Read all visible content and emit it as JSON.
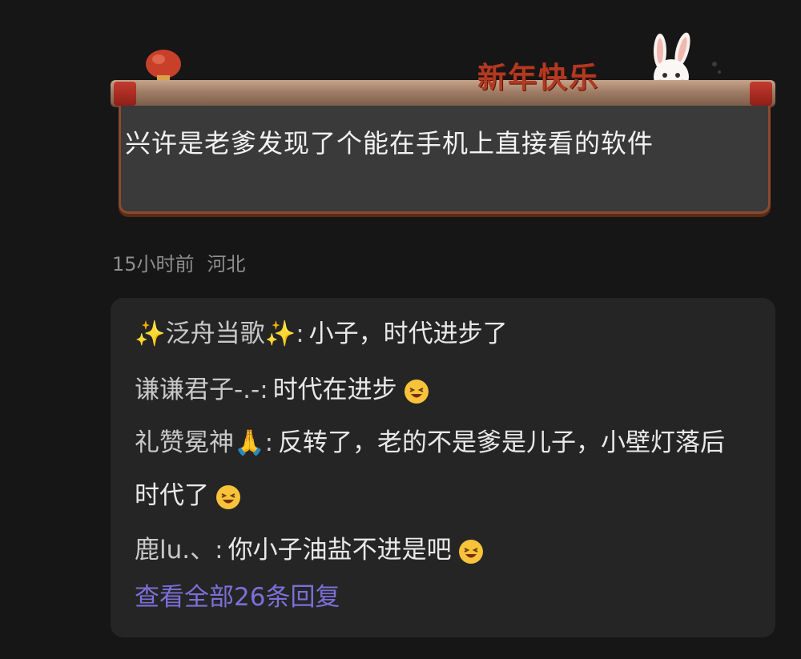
{
  "banner": {
    "title": "新年快乐",
    "comment_text": "兴许是老爹发现了个能在手机上直接看的软件"
  },
  "meta": {
    "time": "15小时前",
    "location": "河北"
  },
  "replies": [
    {
      "name": "✨泛舟当歌✨",
      "separator": ":",
      "text": "小子，时代进步了",
      "emoji": ""
    },
    {
      "name": "谦谦君子-.-",
      "separator": ":",
      "text": "时代在进步",
      "emoji": "laughing-emoji"
    },
    {
      "name": "礼赞冕神🙏",
      "separator": ":",
      "text": "反转了，老的不是爹是儿子，小壁灯落后时代了",
      "emoji": "laughing-emoji"
    },
    {
      "name": "鹿lu.、",
      "separator": ":",
      "text": "你小子油盐不进是吧",
      "emoji": "laughing-emoji"
    }
  ],
  "view_all_label": "查看全部26条回复",
  "colors": {
    "background": "#161616",
    "reply_box": "#252525",
    "link": "#7c6fd8",
    "banner_title": "#b23a22"
  }
}
